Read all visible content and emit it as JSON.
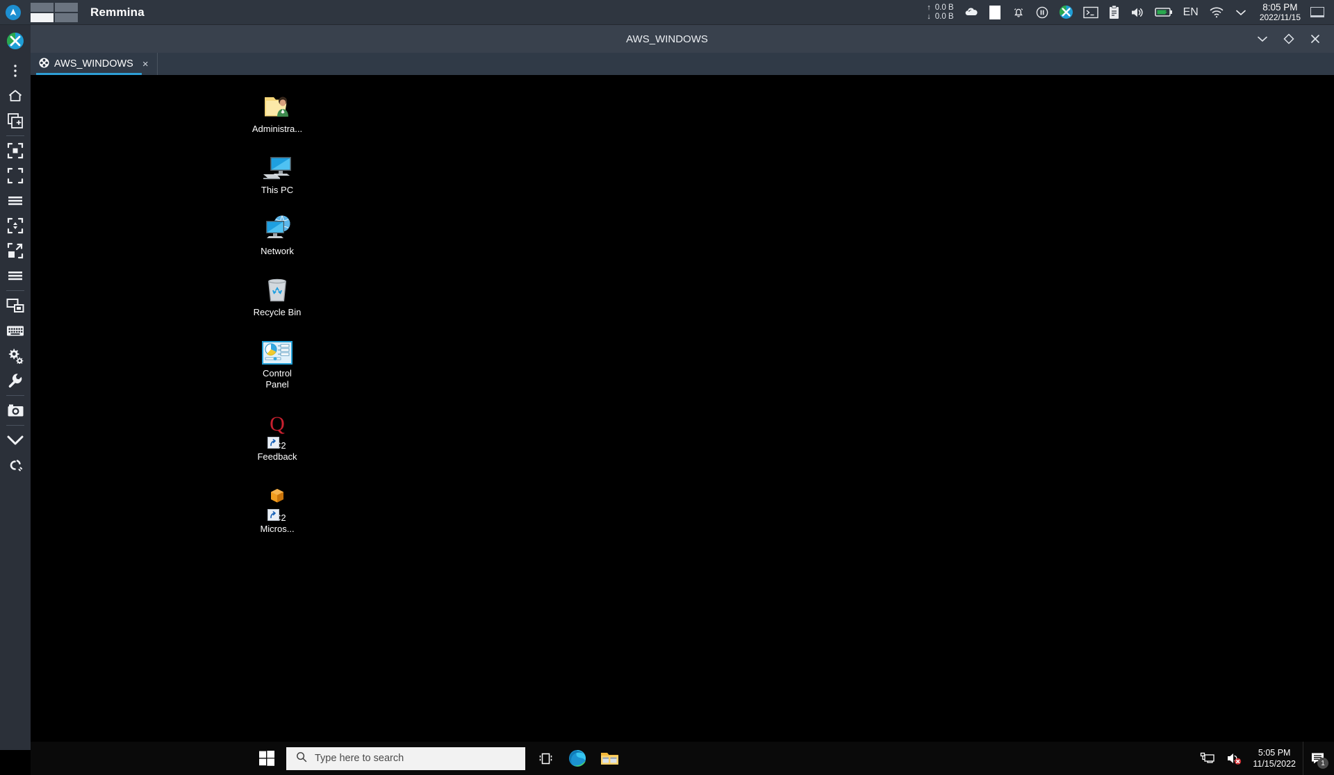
{
  "os_panel": {
    "app_title": "Remmina",
    "logo_icon": "arch-logo-icon",
    "workspaces": [
      {
        "name": "workspace-1",
        "active": false
      },
      {
        "name": "workspace-2",
        "active": false
      },
      {
        "name": "workspace-3",
        "active": true
      },
      {
        "name": "workspace-4",
        "active": false
      }
    ],
    "network_speed": {
      "up_arrow": "↑",
      "down_arrow": "↓",
      "up_value": "0.0 B",
      "down_value": "0.0 B"
    },
    "tray_icons": [
      "weather-cloud-icon",
      "white-square-icon",
      "bell-muted-icon",
      "pause-circle-icon",
      "xfce-app-icon",
      "terminal-icon",
      "clipboard-icon",
      "volume-icon",
      "battery-icon"
    ],
    "language": "EN",
    "wifi_icon": "wifi-icon",
    "chevron_icon": "chevron-down-icon",
    "clock_time": "8:05 PM",
    "clock_date": "2022/11/15",
    "window_icon": "window-icon",
    "bg_color": "#2f3640"
  },
  "remmina": {
    "window_title": "AWS_WINDOWS",
    "header_buttons": [
      "minimize-chevron-icon",
      "maximize-diamond-icon",
      "close-x-icon"
    ],
    "sidebar": {
      "logo": "remmina-logo-icon",
      "items": [
        {
          "name": "menu-kebab-icon",
          "label": "Menu"
        },
        {
          "name": "home-icon",
          "label": "Home"
        },
        {
          "name": "new-connection-icon",
          "label": "New connection"
        },
        {
          "name": "fit-window-icon",
          "label": "Fit window"
        },
        {
          "name": "fullscreen-icon",
          "label": "Fullscreen"
        },
        {
          "name": "toolbar-list-icon",
          "label": "Toolbar"
        },
        {
          "name": "scale-icon",
          "label": "Scaled mode"
        },
        {
          "name": "dynamic-resize-icon",
          "label": "Dynamic resolution"
        },
        {
          "name": "preferences-list-icon",
          "label": "Preferences list"
        },
        {
          "name": "multi-monitor-icon",
          "label": "Multi monitor"
        },
        {
          "name": "keyboard-icon",
          "label": "Grab keyboard"
        },
        {
          "name": "gears-icon",
          "label": "Tools"
        },
        {
          "name": "wrench-icon",
          "label": "Preferences"
        },
        {
          "name": "screenshot-camera-icon",
          "label": "Screenshot"
        },
        {
          "name": "minimize-chevron-icon",
          "label": "Minimize"
        },
        {
          "name": "disconnect-icon",
          "label": "Disconnect"
        }
      ]
    },
    "tabs": [
      {
        "label": "AWS_WINDOWS",
        "icon": "rdp-diamond-icon",
        "close": "×",
        "active": true
      }
    ],
    "accent_color": "#2e9fd6"
  },
  "desktop": {
    "background": "#000000",
    "icons": [
      {
        "name": "desktop-icon-administrator",
        "label": "Administra...",
        "glyph": "user-folder-icon",
        "shortcut": false
      },
      {
        "name": "desktop-icon-this-pc",
        "label": "This PC",
        "glyph": "computer-icon",
        "shortcut": false
      },
      {
        "name": "desktop-icon-network",
        "label": "Network",
        "glyph": "network-globe-icon",
        "shortcut": false
      },
      {
        "name": "desktop-icon-recycle-bin",
        "label": "Recycle Bin",
        "glyph": "recycle-bin-icon",
        "shortcut": false
      },
      {
        "name": "desktop-icon-control-panel",
        "label": "Control\nPanel",
        "glyph": "control-panel-icon",
        "shortcut": false
      },
      {
        "name": "desktop-icon-ec2-feedback",
        "label": "EC2\nFeedback",
        "glyph": "ec2-feedback-q-icon",
        "shortcut": true
      },
      {
        "name": "desktop-icon-ec2-microsoft",
        "label": "EC2\nMicros...",
        "glyph": "ec2-package-icon",
        "shortcut": true
      }
    ]
  },
  "taskbar": {
    "start_icon": "windows-start-icon",
    "search": {
      "placeholder": "Type here to search",
      "value": "",
      "icon": "search-icon"
    },
    "taskview_icon": "task-view-icon",
    "pinned_apps": [
      {
        "name": "edge-browser-icon",
        "label": "Microsoft Edge"
      },
      {
        "name": "file-explorer-icon",
        "label": "File Explorer"
      }
    ],
    "tray": [
      {
        "name": "network-icon",
        "label": "Network"
      },
      {
        "name": "volume-muted-icon",
        "label": "Volume muted"
      }
    ],
    "clock_time": "5:05 PM",
    "clock_date": "11/15/2022",
    "action_center": {
      "icon": "action-center-icon",
      "badge": "1"
    }
  }
}
